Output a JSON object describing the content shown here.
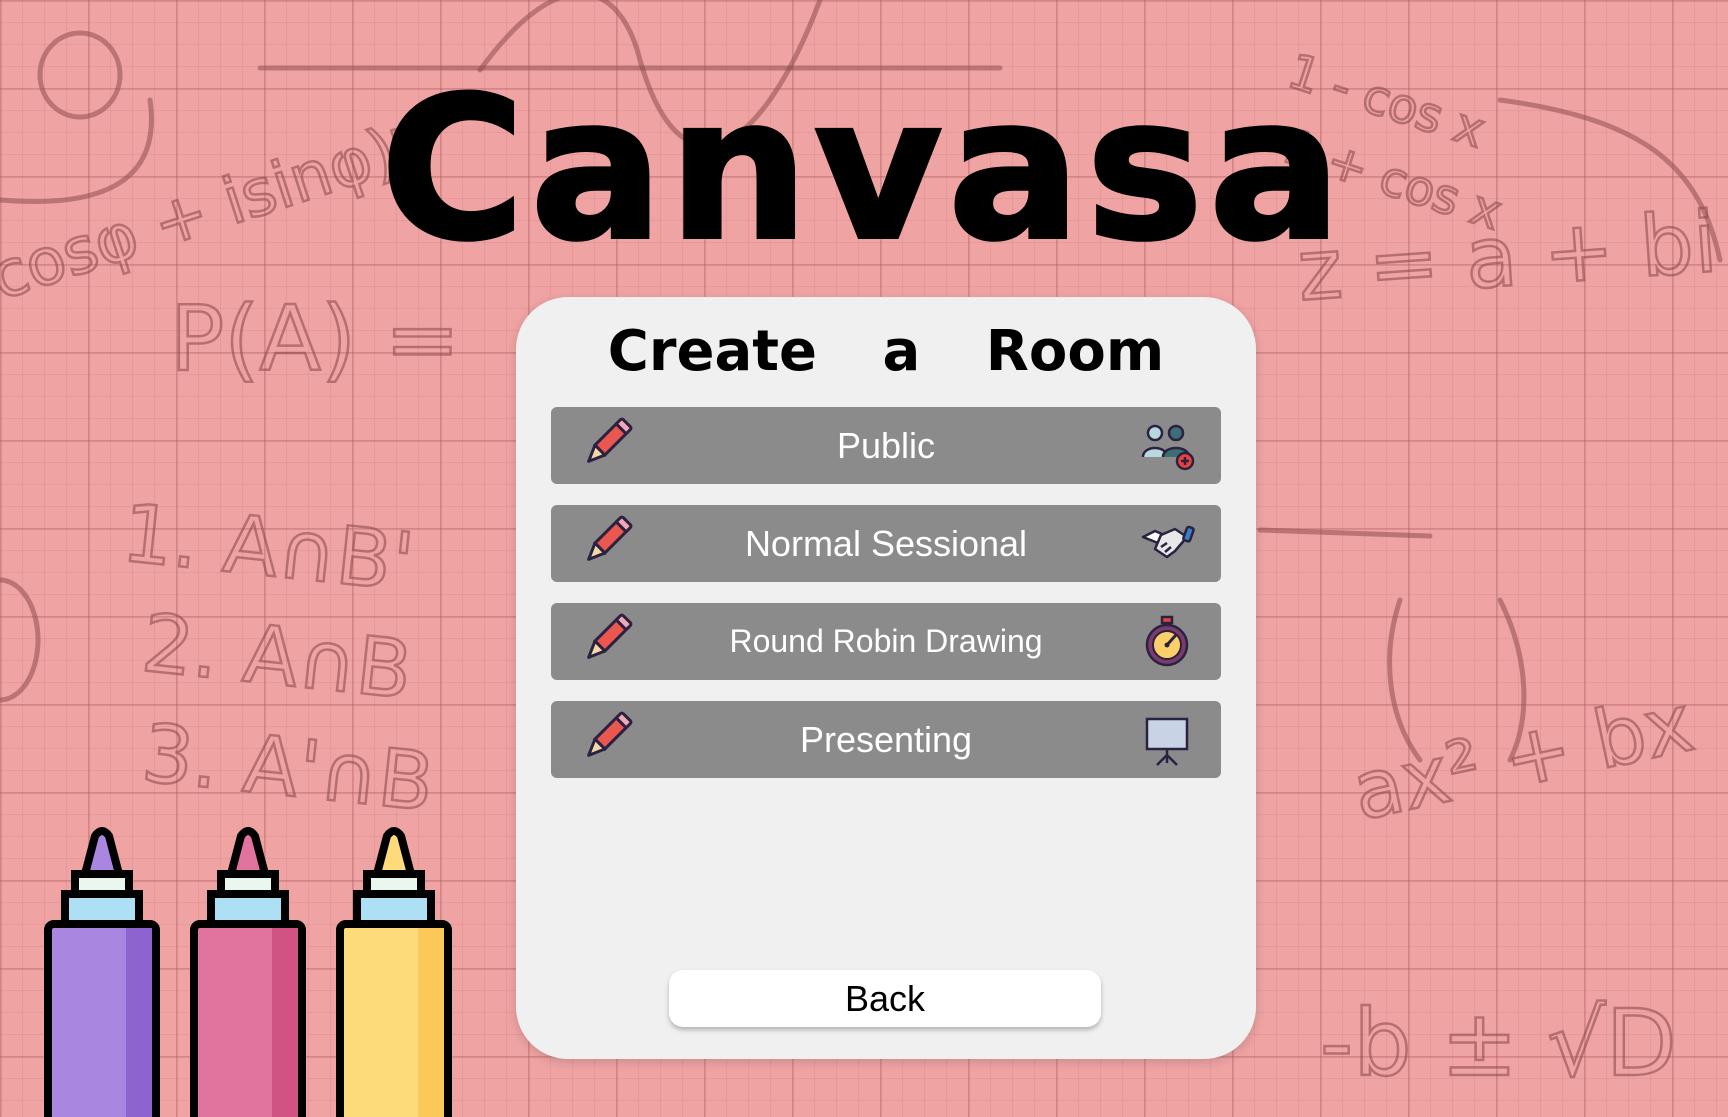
{
  "app": {
    "title": "Canvasa"
  },
  "panel": {
    "title": "Create a Room",
    "options": [
      {
        "label": "Public",
        "icon": "group-add-icon"
      },
      {
        "label": "Normal Sessional",
        "icon": "handshake-icon"
      },
      {
        "label": "Round Robin Drawing",
        "icon": "stopwatch-icon"
      },
      {
        "label": "Presenting",
        "icon": "presentation-board-icon"
      }
    ],
    "back_label": "Back"
  },
  "background": {
    "doodles": [
      "1. A∩B'",
      "2. A∩B",
      "3. A'∩B",
      "P(A) =",
      "cosφ + isinφ)ⁿ",
      "z = a + bi",
      "ax² + bx",
      "-b ± √D",
      "1 - cos x",
      "1 + cos x"
    ]
  },
  "colors": {
    "background": "#efa3a3",
    "panel": "#f0f0f0",
    "option_button": "#8b8b8b",
    "back_button": "#ffffff",
    "marker_purple": "#a987e0",
    "marker_pink": "#e0749f",
    "marker_yellow": "#fedb7a"
  }
}
